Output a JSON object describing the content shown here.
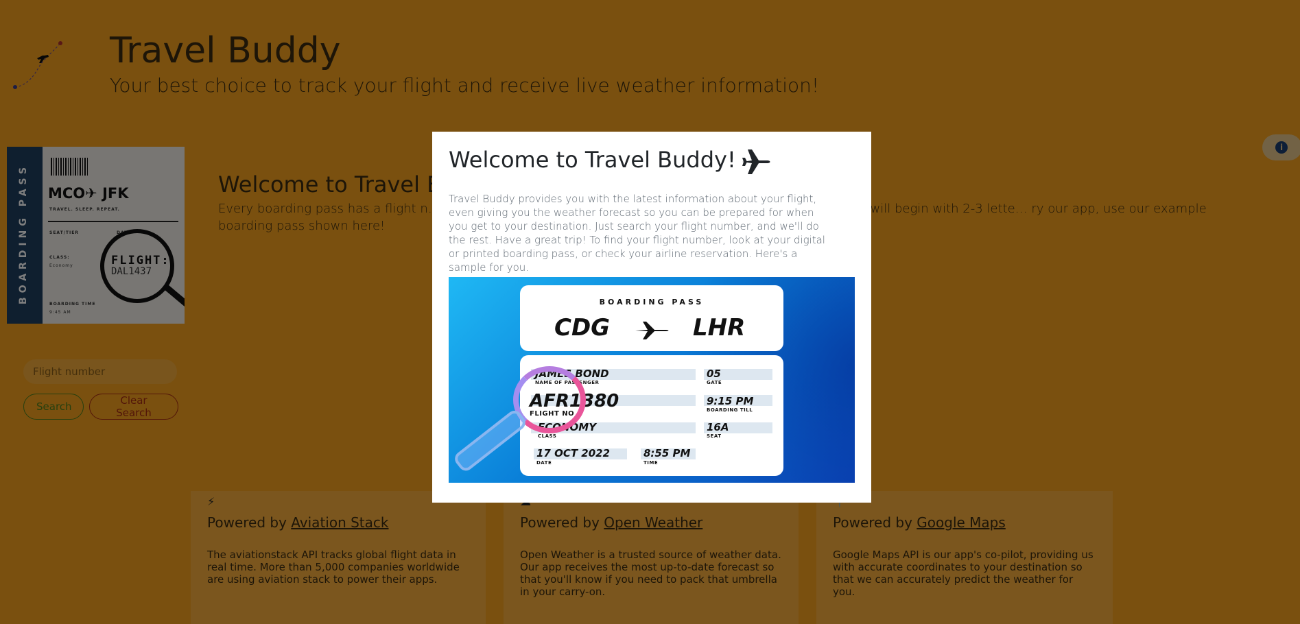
{
  "header": {
    "title": "Travel Buddy",
    "subtitle": "Your best choice to track your flight and receive live weather information!"
  },
  "boarding_pass_thumb": {
    "stub_label": "BOARDING PASS",
    "route": "MCO✈ JFK",
    "tagline": "TRAVEL. SLEEP. REPEAT.",
    "seat_label": "SEAT/TIER",
    "date_label": "DATE",
    "class_label": "CLASS:",
    "class_value": "Economy",
    "boarding_label": "BOARDING TIME",
    "boarding_value": "9:45 AM",
    "flight_label": "FLIGHT:",
    "flight_number": "DAL1437"
  },
  "page_welcome": {
    "title": "Welcome to Travel Bu",
    "text": "Every boarding pass has a flight n…                                                                                                    digital boarding pass. The flight number will be listed as \"Flight\" and will begin with 2-3 lette…                                                                                               ry our app, use our example boarding pass shown here!"
  },
  "search": {
    "placeholder": "Flight number",
    "search_label": "Search",
    "clear_label": "Clear Search"
  },
  "cards": [
    {
      "prefix": "Powered by ",
      "link": "Aviation Stack",
      "text": "The aviationstack API tracks global flight data in real time. More than 5,000 companies worldwide are using aviation stack to power their apps.",
      "icon": "lightning-icon"
    },
    {
      "prefix": "Powered by ",
      "link": "Open Weather",
      "text": "Open Weather is a trusted source of weather data. Our app receives the most up-to-date forecast so that you'll know if you need to pack that umbrella in your carry-on.",
      "icon": "cloud-icon"
    },
    {
      "prefix": "Powered by ",
      "link": "Google Maps",
      "text": "Google Maps API is our app's co-pilot, providing us with accurate coordinates to your destination so that we can accurately predict the weather for you.",
      "icon": "map-pin-icon"
    }
  ],
  "modal": {
    "title": "Welcome to Travel Buddy!",
    "body": "Travel Buddy provides you with the latest information about your flight, even giving you the weather forecast so you can be prepared for when you get to your destination. Just search your flight number, and we'll do the rest. Have a great trip! To find your flight number, look at your digital or printed boarding pass, or check your airline reservation. Here's a sample for you.",
    "sample_pass": {
      "heading": "BOARDING PASS",
      "from": "CDG",
      "to": "LHR",
      "passenger": "JAMES BOND",
      "passenger_label": "NAME OF PASSENGER",
      "flight_no": "AFR1380",
      "flight_no_label": "FLIGHT NO",
      "class": "ECONOMY",
      "class_label": "CLASS",
      "date": "17 OCT 2022",
      "date_label": "DATE",
      "time": "8:55 PM",
      "time_label": "TIME",
      "gate": "05",
      "gate_label": "GATE",
      "boarding_till": "9:15 PM",
      "boarding_till_label": "BOARDING TILL",
      "seat": "16A",
      "seat_label": "SEAT"
    }
  },
  "colors": {
    "page_background": "#f5a11e",
    "overlay": "rgba(0,0,0,0.5)",
    "stub": "#1f3f5f",
    "search_button": "#4b7f1e",
    "clear_button": "#a52a12"
  }
}
